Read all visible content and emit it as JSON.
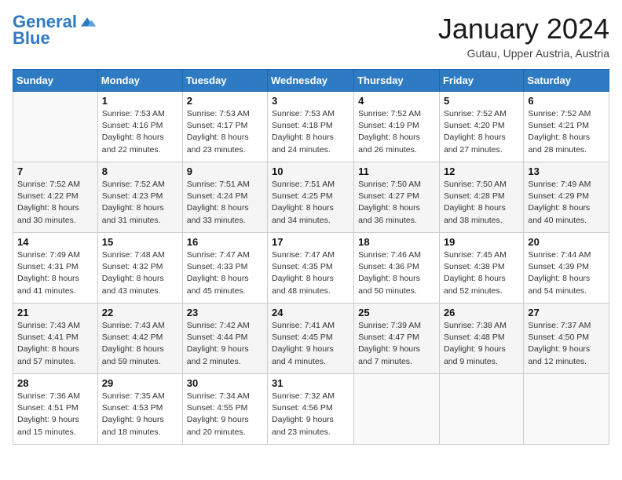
{
  "logo": {
    "line1": "General",
    "line2": "Blue"
  },
  "title": "January 2024",
  "subtitle": "Gutau, Upper Austria, Austria",
  "weekdays": [
    "Sunday",
    "Monday",
    "Tuesday",
    "Wednesday",
    "Thursday",
    "Friday",
    "Saturday"
  ],
  "weeks": [
    [
      {
        "day": "",
        "info": ""
      },
      {
        "day": "1",
        "info": "Sunrise: 7:53 AM\nSunset: 4:16 PM\nDaylight: 8 hours\nand 22 minutes."
      },
      {
        "day": "2",
        "info": "Sunrise: 7:53 AM\nSunset: 4:17 PM\nDaylight: 8 hours\nand 23 minutes."
      },
      {
        "day": "3",
        "info": "Sunrise: 7:53 AM\nSunset: 4:18 PM\nDaylight: 8 hours\nand 24 minutes."
      },
      {
        "day": "4",
        "info": "Sunrise: 7:52 AM\nSunset: 4:19 PM\nDaylight: 8 hours\nand 26 minutes."
      },
      {
        "day": "5",
        "info": "Sunrise: 7:52 AM\nSunset: 4:20 PM\nDaylight: 8 hours\nand 27 minutes."
      },
      {
        "day": "6",
        "info": "Sunrise: 7:52 AM\nSunset: 4:21 PM\nDaylight: 8 hours\nand 28 minutes."
      }
    ],
    [
      {
        "day": "7",
        "info": "Sunrise: 7:52 AM\nSunset: 4:22 PM\nDaylight: 8 hours\nand 30 minutes."
      },
      {
        "day": "8",
        "info": "Sunrise: 7:52 AM\nSunset: 4:23 PM\nDaylight: 8 hours\nand 31 minutes."
      },
      {
        "day": "9",
        "info": "Sunrise: 7:51 AM\nSunset: 4:24 PM\nDaylight: 8 hours\nand 33 minutes."
      },
      {
        "day": "10",
        "info": "Sunrise: 7:51 AM\nSunset: 4:25 PM\nDaylight: 8 hours\nand 34 minutes."
      },
      {
        "day": "11",
        "info": "Sunrise: 7:50 AM\nSunset: 4:27 PM\nDaylight: 8 hours\nand 36 minutes."
      },
      {
        "day": "12",
        "info": "Sunrise: 7:50 AM\nSunset: 4:28 PM\nDaylight: 8 hours\nand 38 minutes."
      },
      {
        "day": "13",
        "info": "Sunrise: 7:49 AM\nSunset: 4:29 PM\nDaylight: 8 hours\nand 40 minutes."
      }
    ],
    [
      {
        "day": "14",
        "info": "Sunrise: 7:49 AM\nSunset: 4:31 PM\nDaylight: 8 hours\nand 41 minutes."
      },
      {
        "day": "15",
        "info": "Sunrise: 7:48 AM\nSunset: 4:32 PM\nDaylight: 8 hours\nand 43 minutes."
      },
      {
        "day": "16",
        "info": "Sunrise: 7:47 AM\nSunset: 4:33 PM\nDaylight: 8 hours\nand 45 minutes."
      },
      {
        "day": "17",
        "info": "Sunrise: 7:47 AM\nSunset: 4:35 PM\nDaylight: 8 hours\nand 48 minutes."
      },
      {
        "day": "18",
        "info": "Sunrise: 7:46 AM\nSunset: 4:36 PM\nDaylight: 8 hours\nand 50 minutes."
      },
      {
        "day": "19",
        "info": "Sunrise: 7:45 AM\nSunset: 4:38 PM\nDaylight: 8 hours\nand 52 minutes."
      },
      {
        "day": "20",
        "info": "Sunrise: 7:44 AM\nSunset: 4:39 PM\nDaylight: 8 hours\nand 54 minutes."
      }
    ],
    [
      {
        "day": "21",
        "info": "Sunrise: 7:43 AM\nSunset: 4:41 PM\nDaylight: 8 hours\nand 57 minutes."
      },
      {
        "day": "22",
        "info": "Sunrise: 7:43 AM\nSunset: 4:42 PM\nDaylight: 8 hours\nand 59 minutes."
      },
      {
        "day": "23",
        "info": "Sunrise: 7:42 AM\nSunset: 4:44 PM\nDaylight: 9 hours\nand 2 minutes."
      },
      {
        "day": "24",
        "info": "Sunrise: 7:41 AM\nSunset: 4:45 PM\nDaylight: 9 hours\nand 4 minutes."
      },
      {
        "day": "25",
        "info": "Sunrise: 7:39 AM\nSunset: 4:47 PM\nDaylight: 9 hours\nand 7 minutes."
      },
      {
        "day": "26",
        "info": "Sunrise: 7:38 AM\nSunset: 4:48 PM\nDaylight: 9 hours\nand 9 minutes."
      },
      {
        "day": "27",
        "info": "Sunrise: 7:37 AM\nSunset: 4:50 PM\nDaylight: 9 hours\nand 12 minutes."
      }
    ],
    [
      {
        "day": "28",
        "info": "Sunrise: 7:36 AM\nSunset: 4:51 PM\nDaylight: 9 hours\nand 15 minutes."
      },
      {
        "day": "29",
        "info": "Sunrise: 7:35 AM\nSunset: 4:53 PM\nDaylight: 9 hours\nand 18 minutes."
      },
      {
        "day": "30",
        "info": "Sunrise: 7:34 AM\nSunset: 4:55 PM\nDaylight: 9 hours\nand 20 minutes."
      },
      {
        "day": "31",
        "info": "Sunrise: 7:32 AM\nSunset: 4:56 PM\nDaylight: 9 hours\nand 23 minutes."
      },
      {
        "day": "",
        "info": ""
      },
      {
        "day": "",
        "info": ""
      },
      {
        "day": "",
        "info": ""
      }
    ]
  ]
}
